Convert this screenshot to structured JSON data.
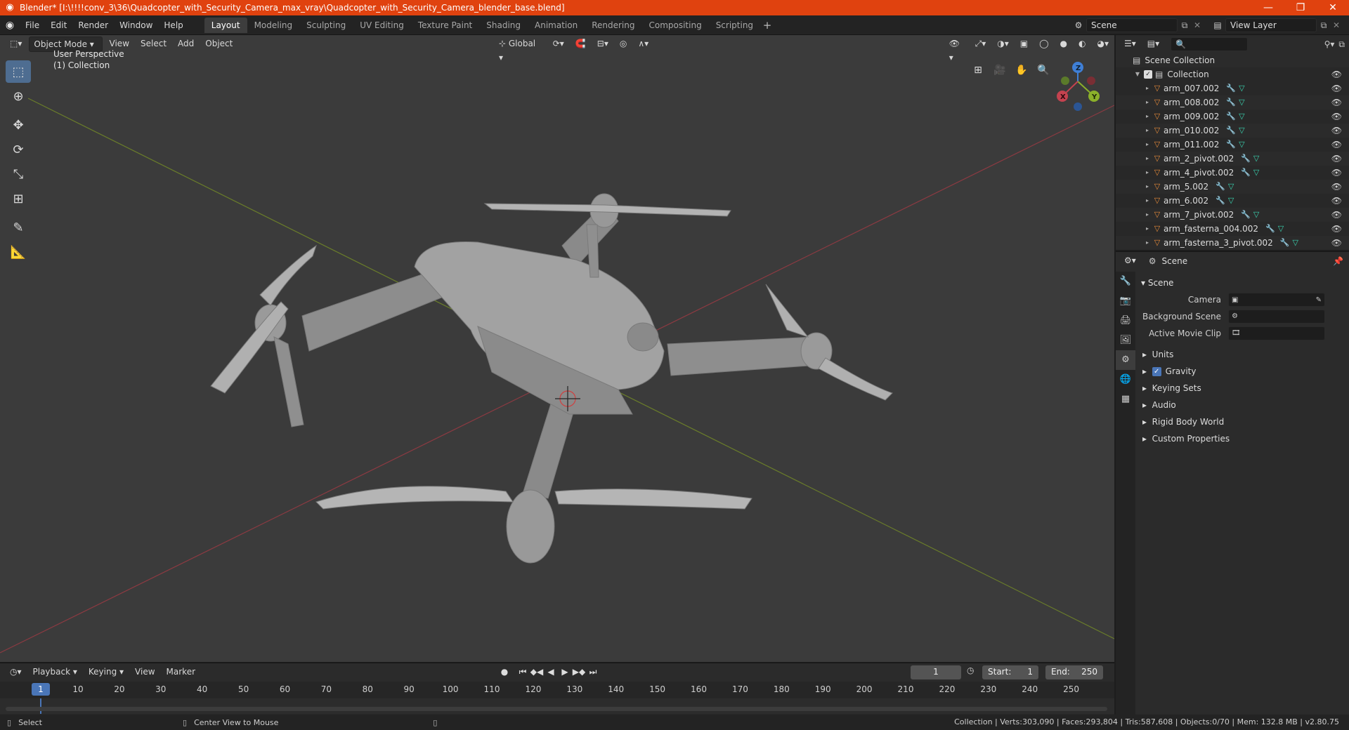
{
  "window": {
    "title": "Blender* [I:\\!!!!conv_3\\36\\Quadcopter_with_Security_Camera_max_vray\\Quadcopter_with_Security_Camera_blender_base.blend]",
    "minimize": "—",
    "maximize": "❐",
    "close": "✕"
  },
  "menu": [
    "File",
    "Edit",
    "Render",
    "Window",
    "Help"
  ],
  "workspaces": [
    "Layout",
    "Modeling",
    "Sculpting",
    "UV Editing",
    "Texture Paint",
    "Shading",
    "Animation",
    "Rendering",
    "Compositing",
    "Scripting"
  ],
  "active_workspace": "Layout",
  "scene_name": "Scene",
  "view_layer": "View Layer",
  "viewport": {
    "mode": "Object Mode",
    "menus": [
      "View",
      "Select",
      "Add",
      "Object"
    ],
    "orientation": "Global",
    "perspective_label": "User Perspective",
    "collection_label": "(1) Collection"
  },
  "gizmo": {
    "x": "X",
    "y": "Y",
    "z": "Z"
  },
  "timeline": {
    "menus": [
      "Playback",
      "Keying",
      "View",
      "Marker"
    ],
    "current_frame": "1",
    "start_label": "Start:",
    "start": "1",
    "end_label": "End:",
    "end": "250",
    "ticks": [
      "10",
      "20",
      "30",
      "40",
      "50",
      "60",
      "70",
      "80",
      "90",
      "100",
      "110",
      "120",
      "130",
      "140",
      "150",
      "160",
      "170",
      "180",
      "190",
      "200",
      "210",
      "220",
      "230",
      "240",
      "250"
    ],
    "cursor_frame": "1"
  },
  "statusbar": {
    "left_action": "Select",
    "middle_action": "Center View to Mouse",
    "stats": "Collection | Verts:303,090 | Faces:293,804 | Tris:587,608 | Objects:0/70 | Mem: 132.8 MB | v2.80.75"
  },
  "outliner": {
    "root": "Scene Collection",
    "collection": "Collection",
    "items": [
      "arm_007.002",
      "arm_008.002",
      "arm_009.002",
      "arm_010.002",
      "arm_011.002",
      "arm_2_pivot.002",
      "arm_4_pivot.002",
      "arm_5.002",
      "arm_6.002",
      "arm_7_pivot.002",
      "arm_fasterna_004.002",
      "arm_fasterna_3_pivot.002"
    ]
  },
  "properties": {
    "context": "Scene",
    "panel_title": "Scene",
    "fields": [
      "Camera",
      "Background Scene",
      "Active Movie Clip"
    ],
    "subpanels": [
      "Units",
      "Gravity",
      "Keying Sets",
      "Audio",
      "Rigid Body World",
      "Custom Properties"
    ]
  },
  "colors": {
    "titlebar": "#e0420f",
    "x_axis": "#c4424f",
    "y_axis": "#8bb02a",
    "z_axis": "#3f7fd6",
    "accent": "#4a76b8"
  }
}
